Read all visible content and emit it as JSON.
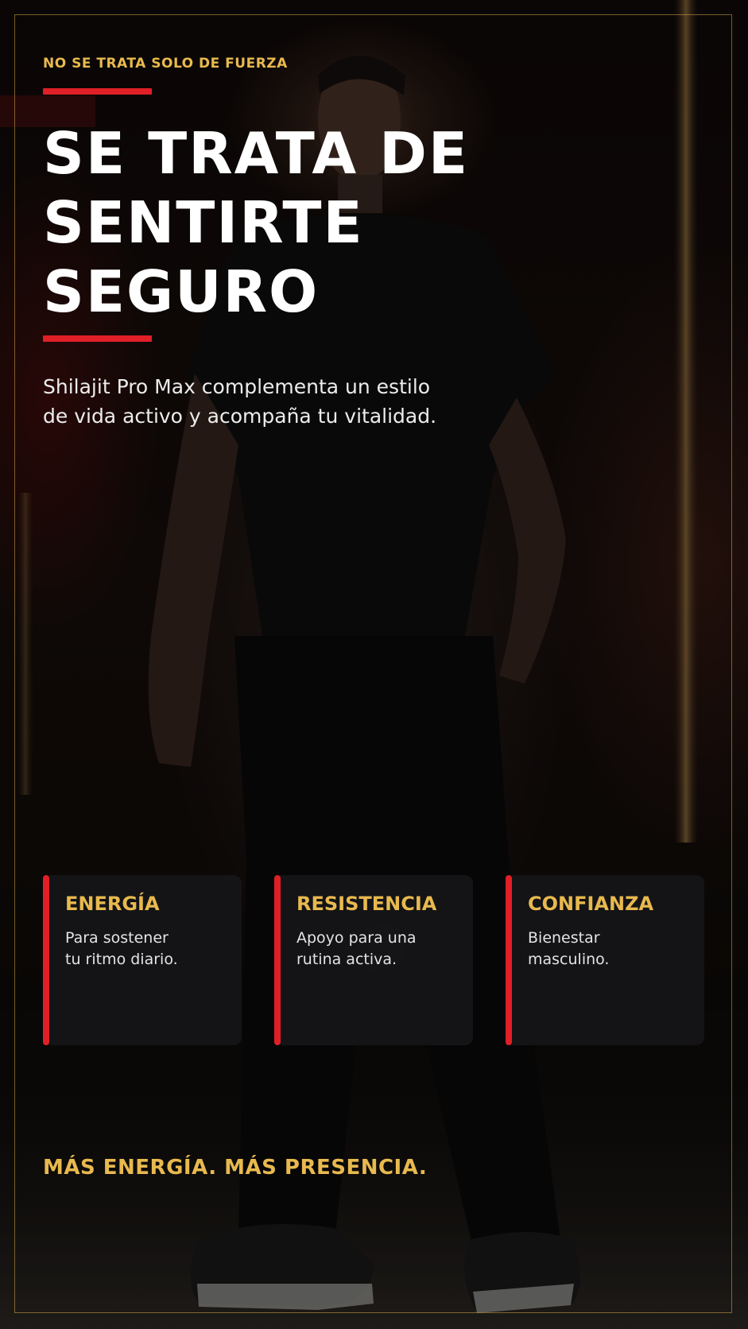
{
  "eyebrow": "NO SE TRATA SOLO DE FUERZA",
  "headline": {
    "line1": "SE TRATA DE",
    "line2": "SENTIRTE",
    "line3": "SEGURO"
  },
  "subtext": {
    "line1": "Shilajit Pro Max complementa un estilo",
    "line2": "de vida activo y acompaña tu vitalidad."
  },
  "cards": [
    {
      "title": "ENERGÍA",
      "line1": "Para sostener",
      "line2": "tu ritmo diario."
    },
    {
      "title": "RESISTENCIA",
      "line1": "Apoyo para una",
      "line2": "rutina activa."
    },
    {
      "title": "CONFIANZA",
      "line1": "Bienestar",
      "line2": "masculino."
    }
  ],
  "tagline": "MÁS ENERGÍA. MÁS PRESENCIA.",
  "colors": {
    "gold": "#e8b94e",
    "red": "#e01f27",
    "text": "#ffffff",
    "card_bg": "#161618",
    "background": "#0b0807"
  }
}
